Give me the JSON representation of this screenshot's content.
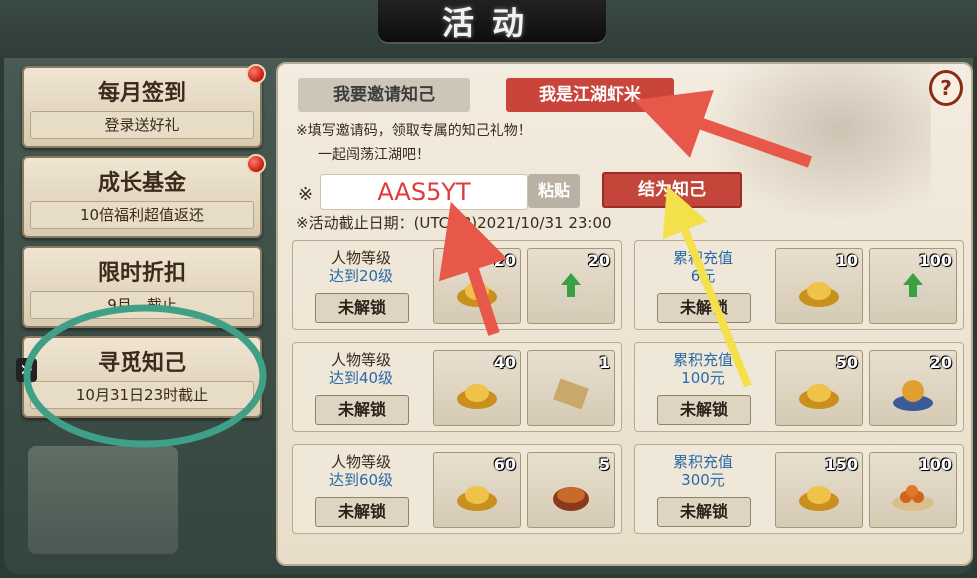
{
  "header": {
    "title": "活动"
  },
  "sidebar": {
    "items": [
      {
        "name": "每月签到",
        "sub": "登录送好礼",
        "has_dot": true
      },
      {
        "name": "成长基金",
        "sub": "10倍福利超值返还",
        "has_dot": true
      },
      {
        "name": "限时折扣",
        "sub": "9月…截止",
        "has_dot": false
      },
      {
        "name": "寻觅知己",
        "sub": "10月31日23时截止",
        "has_dot": false,
        "selected": true
      }
    ]
  },
  "main": {
    "tabs": [
      {
        "label": "我要邀请知己",
        "active": false
      },
      {
        "label": "我是江湖虾米",
        "active": true
      }
    ],
    "help_label": "?",
    "notes": [
      "※填写邀请码，领取专属的知己礼物！",
      "一起闯荡江湖吧！"
    ],
    "mark": "※",
    "invite_code_value": "AAS5YT",
    "paste_label": "粘贴",
    "bind_label": "结为知己",
    "deadline": "※活动截止日期：(UTC+8)2021/10/31 23:00"
  },
  "rewards_left": [
    {
      "cond1": "人物等级",
      "cond2": "达到20级",
      "btn": "未解锁",
      "items": [
        {
          "icon": "gold-ingot-icon",
          "count": "20"
        },
        {
          "icon": "upgrade-bag-icon",
          "count": "20"
        }
      ]
    },
    {
      "cond1": "人物等级",
      "cond2": "达到40级",
      "btn": "未解锁",
      "items": [
        {
          "icon": "gold-ingot-icon",
          "count": "40"
        },
        {
          "icon": "scroll-icon",
          "count": "1"
        }
      ]
    },
    {
      "cond1": "人物等级",
      "cond2": "达到60级",
      "btn": "未解锁",
      "items": [
        {
          "icon": "gold-ingot-icon",
          "count": "60"
        },
        {
          "icon": "cake-box-icon",
          "count": "5"
        }
      ]
    }
  ],
  "rewards_right": [
    {
      "cond1": "累积充值",
      "cond2": "6元",
      "btn": "未解锁",
      "items": [
        {
          "icon": "gold-ingot-icon",
          "count": "10"
        },
        {
          "icon": "upgrade-bag-icon",
          "count": "100"
        }
      ]
    },
    {
      "cond1": "累积充值",
      "cond2": "100元",
      "btn": "未解锁",
      "items": [
        {
          "icon": "gold-ingot-icon",
          "count": "50"
        },
        {
          "icon": "orb-icon",
          "count": "20"
        }
      ]
    },
    {
      "cond1": "累积充值",
      "cond2": "300元",
      "btn": "未解锁",
      "items": [
        {
          "icon": "gold-ingot-icon",
          "count": "150"
        },
        {
          "icon": "food-plate-icon",
          "count": "100"
        }
      ]
    }
  ],
  "colors": {
    "accent_red": "#c4463b",
    "code_text": "#e03a3a",
    "annotation_circle": "#3fa087",
    "arrow_red": "#e8584a",
    "arrow_yellow": "#f4e04a"
  }
}
